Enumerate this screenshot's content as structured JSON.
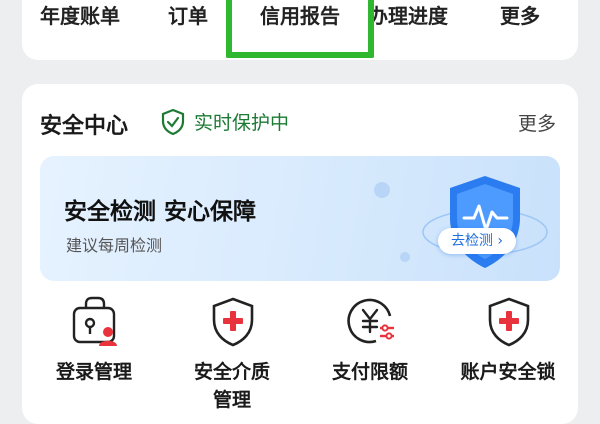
{
  "top_tabs": [
    "年度账单",
    "订单",
    "信用报告",
    "办理进度",
    "更多"
  ],
  "security": {
    "title": "安全中心",
    "status": "实时保护中",
    "more": "更多",
    "banner": {
      "title": "安全检测 安心保障",
      "subtitle": "建议每周检测",
      "button": "去检测 ›"
    },
    "items": [
      {
        "label": "登录管理",
        "icon": "lock-user-icon"
      },
      {
        "label": "安全介质\n管理",
        "icon": "shield-plus-icon"
      },
      {
        "label": "支付限额",
        "icon": "yuan-limit-icon"
      },
      {
        "label": "账户安全锁",
        "icon": "shield-plus-icon"
      }
    ]
  },
  "colors": {
    "highlight": "#2fb72f",
    "status_green": "#1d7a34",
    "accent_red": "#e8323c",
    "accent_blue": "#1e6ee0"
  }
}
